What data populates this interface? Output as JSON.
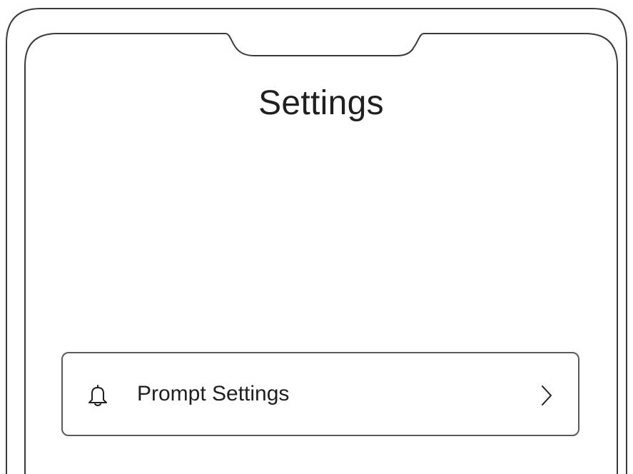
{
  "header": {
    "title": "Settings"
  },
  "settings_list": {
    "items": [
      {
        "label": "Prompt Settings",
        "icon": "bell-icon",
        "trailing_icon": "chevron-right-icon"
      }
    ]
  },
  "colors": {
    "outline": "#3a3a3a",
    "text": "#1f1f1f",
    "background": "#ffffff"
  }
}
